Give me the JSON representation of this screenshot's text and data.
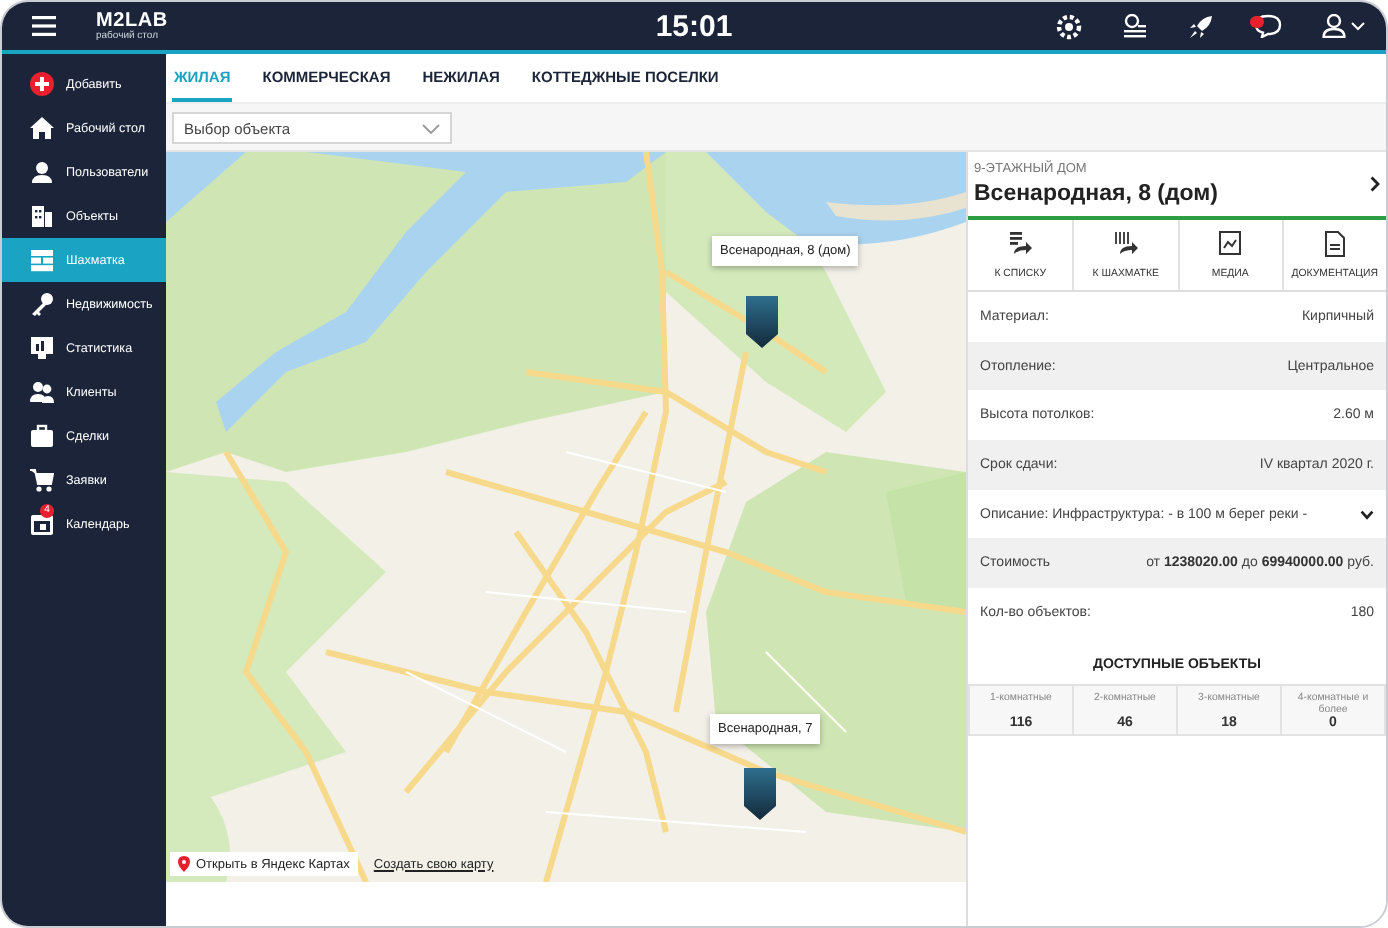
{
  "topbar": {
    "logo": "M2LAB",
    "logo_subtitle": "рабочий стол",
    "time": "15:01",
    "notification_badge": true
  },
  "sidebar": {
    "items": [
      {
        "label": "Добавить",
        "selected": false
      },
      {
        "label": "Рабочий стол",
        "selected": false
      },
      {
        "label": "Пользователи",
        "selected": false
      },
      {
        "label": "Объекты",
        "selected": false
      },
      {
        "label": "Шахматка",
        "selected": true
      },
      {
        "label": "Недвижимость",
        "selected": false
      },
      {
        "label": "Статистика",
        "selected": false
      },
      {
        "label": "Клиенты",
        "selected": false
      },
      {
        "label": "Сделки",
        "selected": false
      },
      {
        "label": "Заявки",
        "selected": false
      },
      {
        "label": "Календарь",
        "selected": false,
        "badge": "4"
      }
    ]
  },
  "tabs": [
    {
      "label": "ЖИЛАЯ",
      "selected": true
    },
    {
      "label": "КОММЕРЧЕСКАЯ",
      "selected": false
    },
    {
      "label": "НЕЖИЛАЯ",
      "selected": false
    },
    {
      "label": "КОТТЕДЖНЫЕ ПОСЕЛКИ",
      "selected": false
    }
  ],
  "object_select": {
    "placeholder": "Выбор объекта"
  },
  "map": {
    "markers": [
      {
        "label": "Всенародная, 8 (дом)"
      },
      {
        "label": "Всенародная, 7"
      }
    ],
    "open_link": "Открыть в Яндекс Картах",
    "create_link": "Создать свою карту"
  },
  "detail": {
    "subtitle": "9-ЭТАЖНЫЙ ДОМ",
    "title": "Всенародная, 8 (дом)",
    "actions": [
      {
        "label": "К СПИСКУ"
      },
      {
        "label": "К ШАХМАТКЕ"
      },
      {
        "label": "МЕДИА"
      },
      {
        "label": "ДОКУМЕНТАЦИЯ"
      }
    ],
    "properties": [
      {
        "kind": "plain",
        "label": "Материал:",
        "value": "Кирпичный"
      },
      {
        "kind": "plain",
        "label": "Отопление:",
        "value": "Центральное"
      },
      {
        "kind": "plain",
        "label": "Высота потолков:",
        "value": "2.60 м"
      },
      {
        "kind": "plain",
        "label": "Срок сдачи:",
        "value": "IV квартал 2020 г."
      },
      {
        "kind": "expandable",
        "label": "Описание: Инфраструктура: - в 100 м берег реки -",
        "expanded": false
      },
      {
        "kind": "plain",
        "label": "Стоимость",
        "value": "от **1238020.00** до **69940000.00** руб."
      },
      {
        "kind": "plain",
        "label": "Кол-во объектов:",
        "value": "180"
      }
    ],
    "available_title": "ДОСТУПНЫЕ ОБЪЕКТЫ",
    "available": [
      {
        "label": "1-комнатные",
        "count": "116"
      },
      {
        "label": "2-комнатные",
        "count": "46"
      },
      {
        "label": "3-комнатные",
        "count": "18"
      },
      {
        "label": "4-комнатные и более",
        "count": "0"
      }
    ]
  }
}
